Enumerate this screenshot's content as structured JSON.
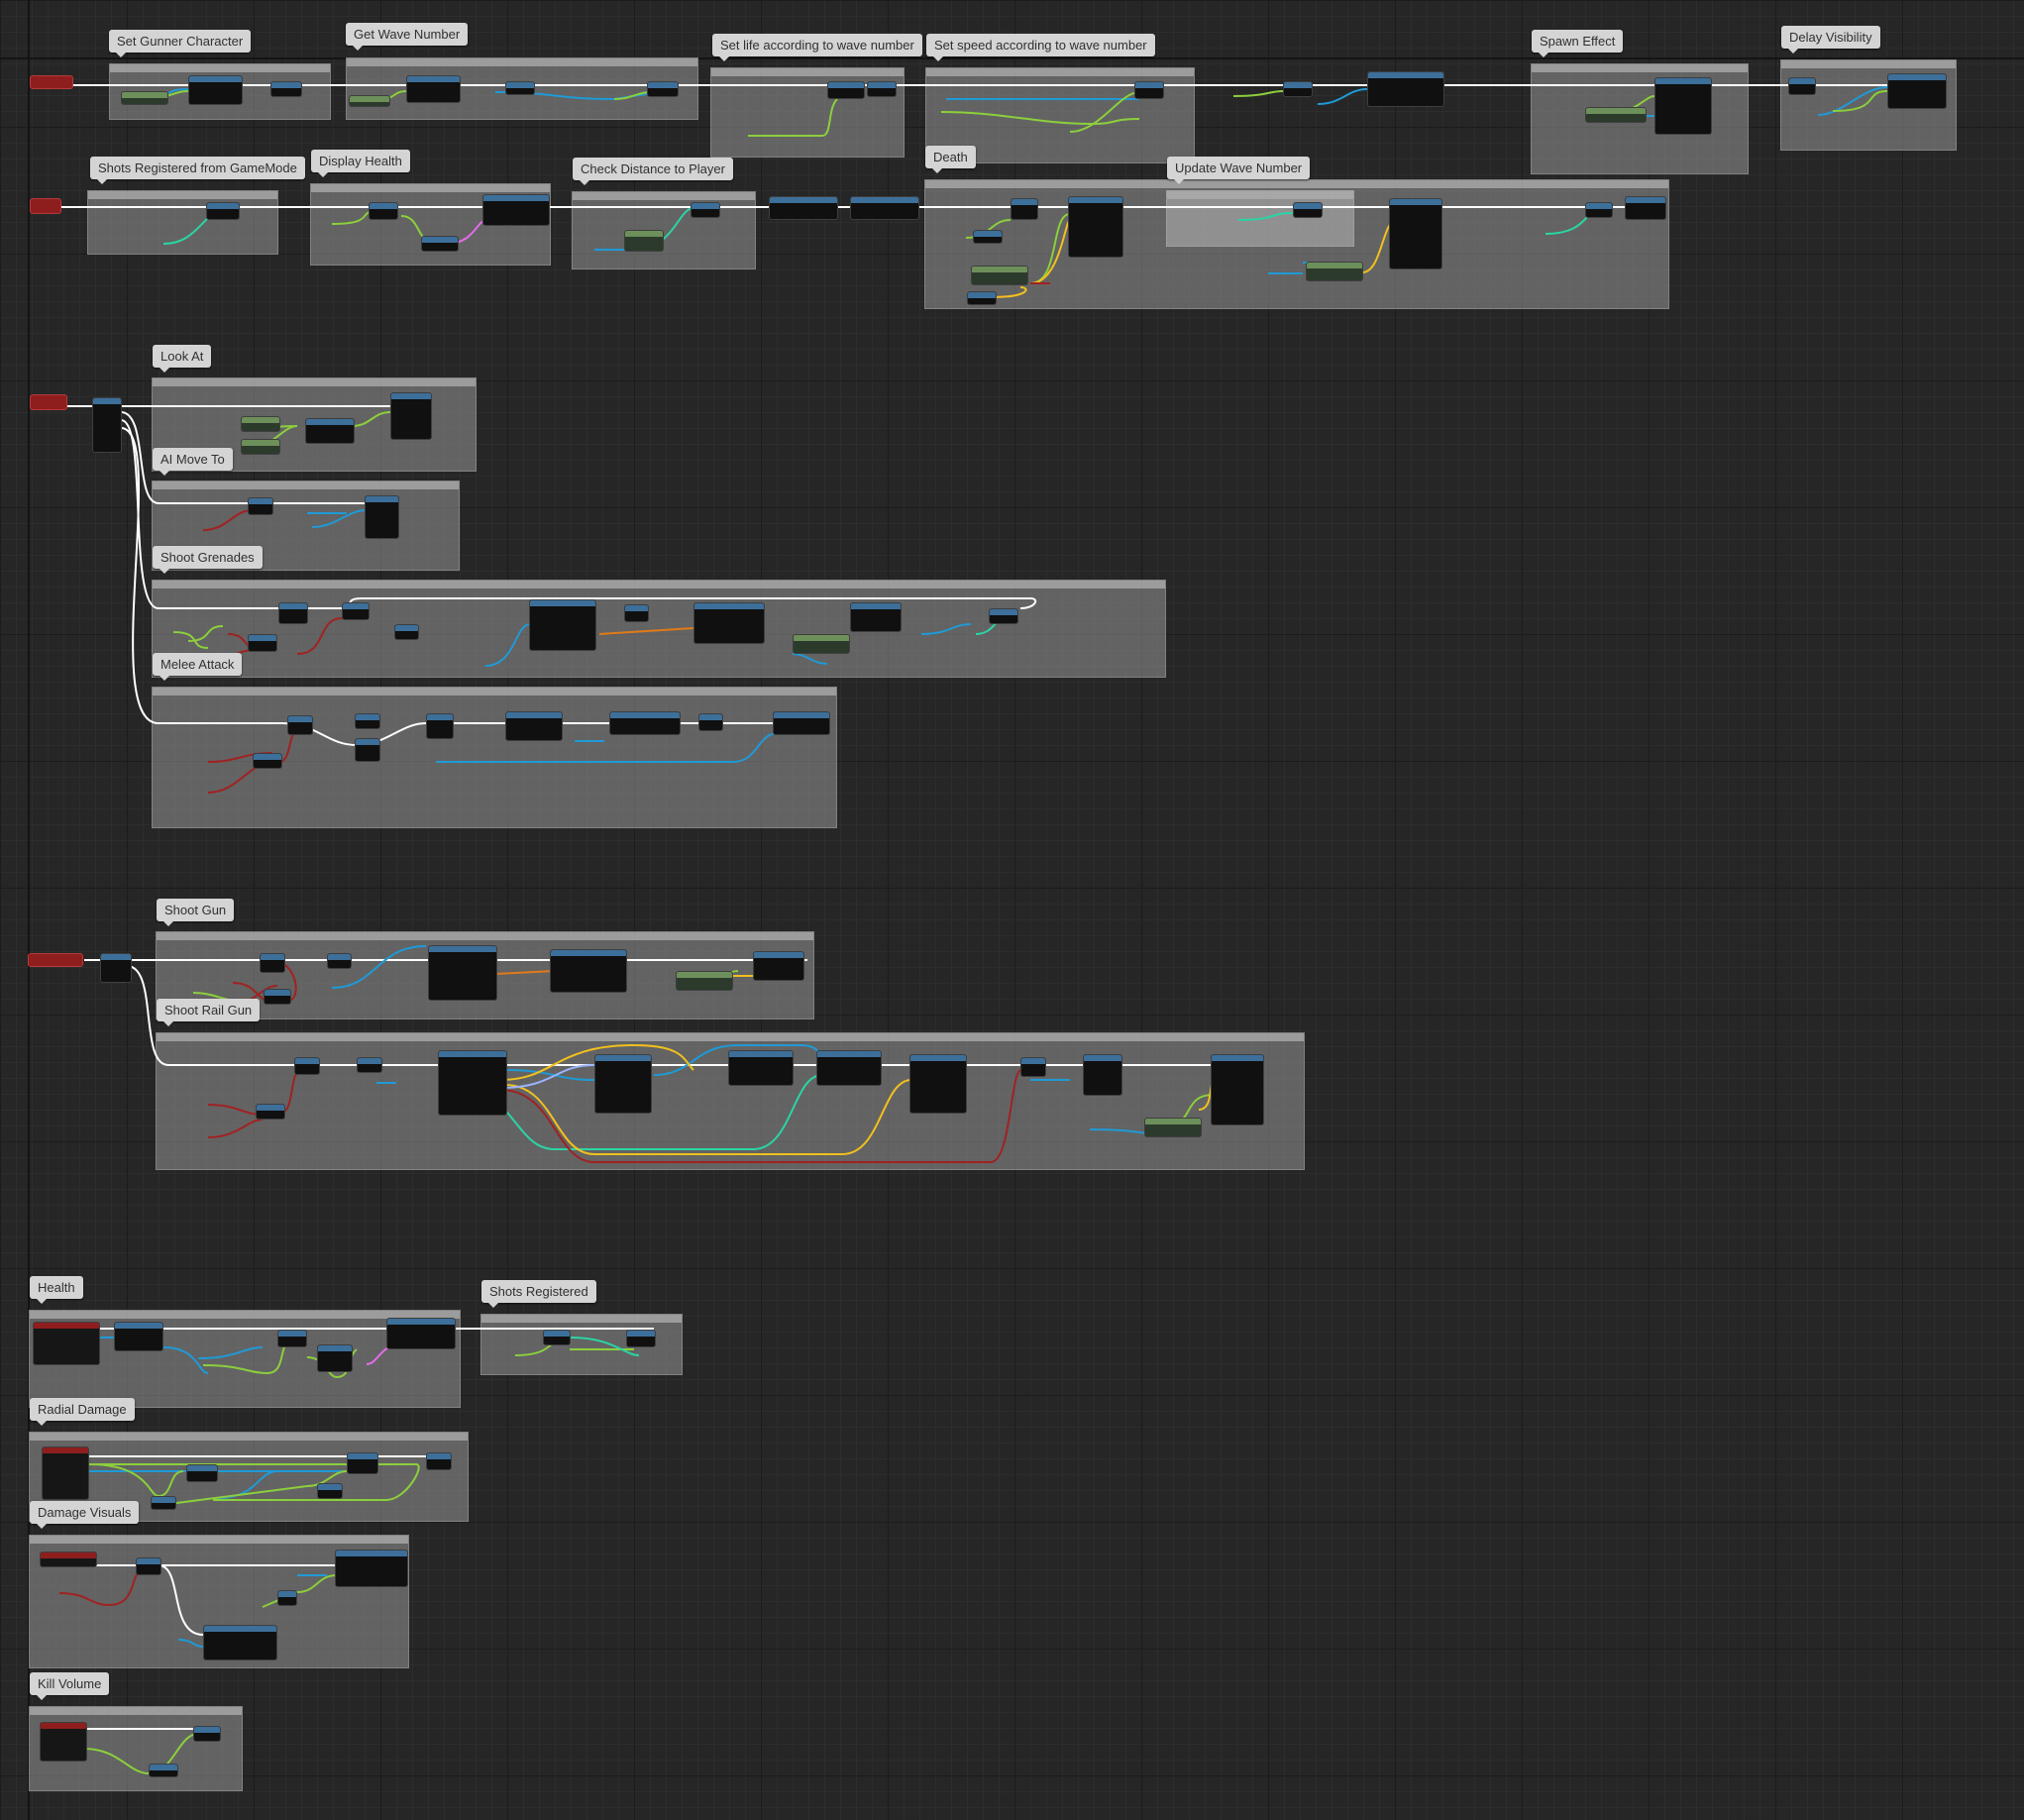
{
  "comments": [
    {
      "id": "set-gunner-character",
      "label": "Set Gunner Character"
    },
    {
      "id": "get-wave-number",
      "label": "Get Wave Number"
    },
    {
      "id": "set-life-wave",
      "label": "Set life according to wave number"
    },
    {
      "id": "set-speed-wave",
      "label": "Set speed according to wave number"
    },
    {
      "id": "spawn-effect",
      "label": "Spawn Effect"
    },
    {
      "id": "delay-visibility",
      "label": "Delay Visibility"
    },
    {
      "id": "shots-registered-gamemode",
      "label": "Shots Registered from GameMode"
    },
    {
      "id": "display-health",
      "label": "Display Health"
    },
    {
      "id": "check-distance",
      "label": "Check Distance to Player"
    },
    {
      "id": "death",
      "label": "Death"
    },
    {
      "id": "update-wave-number",
      "label": "Update Wave Number"
    },
    {
      "id": "look-at",
      "label": "Look At"
    },
    {
      "id": "ai-move-to",
      "label": "AI Move To"
    },
    {
      "id": "shoot-grenades",
      "label": "Shoot Grenades"
    },
    {
      "id": "melee-attack",
      "label": "Melee Attack"
    },
    {
      "id": "shoot-gun",
      "label": "Shoot Gun"
    },
    {
      "id": "shoot-rail-gun",
      "label": "Shoot Rail Gun"
    },
    {
      "id": "health",
      "label": "Health"
    },
    {
      "id": "shots-registered",
      "label": "Shots Registered"
    },
    {
      "id": "radial-damage",
      "label": "Radial Damage"
    },
    {
      "id": "damage-visuals",
      "label": "Damage Visuals"
    },
    {
      "id": "kill-volume",
      "label": "Kill Volume"
    }
  ],
  "colors": {
    "background": "#262626",
    "exec_wire": "#ffffff",
    "object_wire": "#1f9ad6",
    "float_wire": "#8ccf3c",
    "bool_wire": "#8a1f1f",
    "vector_wire": "#f2c01e",
    "struct_wire": "#2bd4a4",
    "rotator_wire": "#9ab4ff",
    "string_wire": "#e26de8",
    "event_header": "#8e1e1e",
    "function_header": "#3c6f9a",
    "variable_node": "#6d8f5a"
  }
}
